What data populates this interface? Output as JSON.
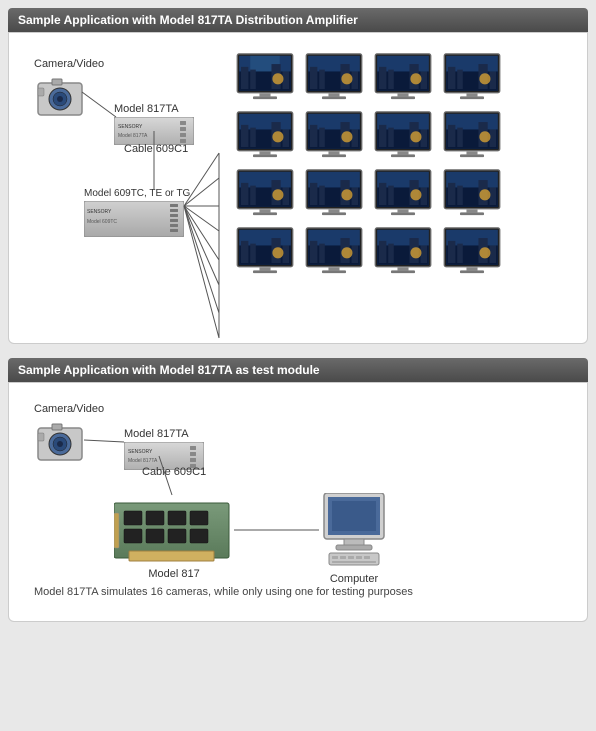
{
  "section1": {
    "header": "Sample Application with Model 817TA Distribution Amplifier",
    "camera_label": "Camera/Video",
    "model817ta_label": "Model 817TA",
    "cable609c1_label": "Cable 609C1",
    "model609tc_label": "Model 609TC, TE or TG",
    "monitor_rows": 4,
    "monitor_cols": 4
  },
  "section2": {
    "header": "Sample Application with Model 817TA as test module",
    "camera_label": "Camera/Video",
    "model817ta_label": "Model 817TA",
    "cable609c1_label": "Cable 609C1",
    "model817_label": "Model 817",
    "computer_label": "Computer",
    "note": "Model 817TA simulates 16 cameras, while only using one for testing purposes"
  }
}
